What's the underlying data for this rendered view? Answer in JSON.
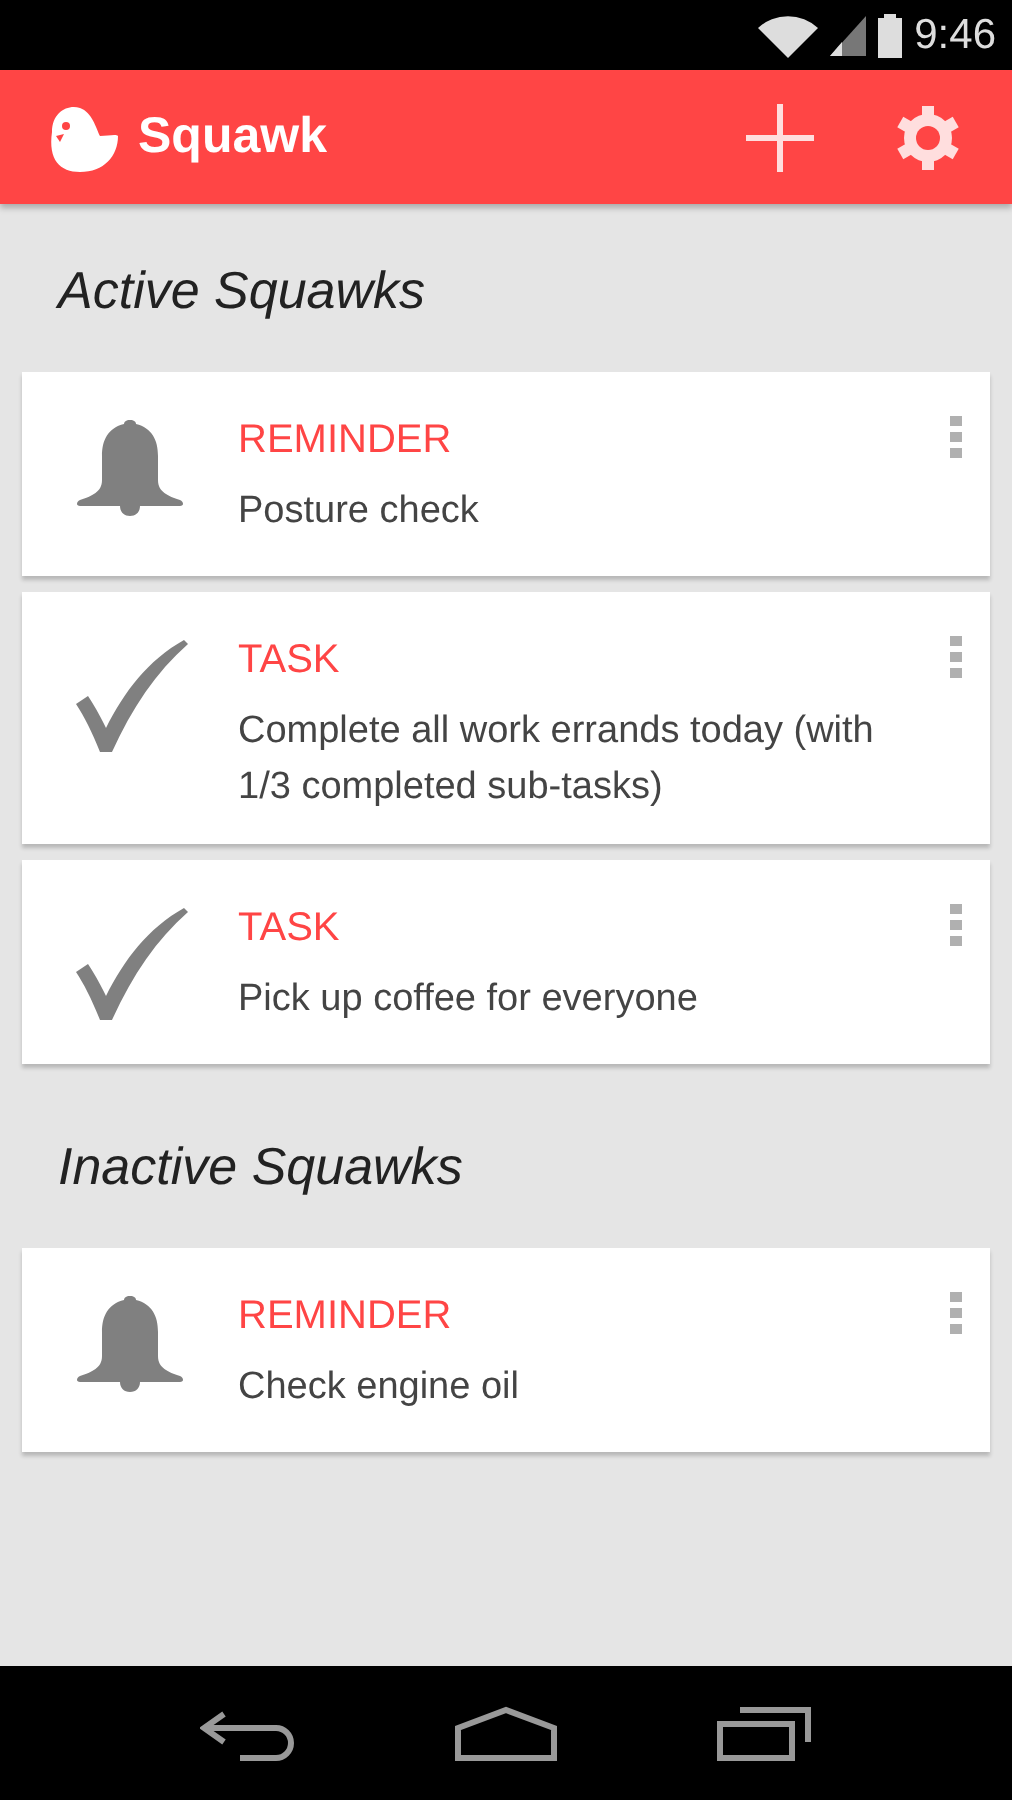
{
  "status_bar": {
    "time": "9:46"
  },
  "app_bar": {
    "title": "Squawk"
  },
  "sections": [
    {
      "title": "Active Squawks",
      "items": [
        {
          "kind": "reminder",
          "type": "REMINDER",
          "description": "Posture check"
        },
        {
          "kind": "task",
          "type": "TASK",
          "description": "Complete all work errands today (with 1/3 completed sub-tasks)"
        },
        {
          "kind": "task",
          "type": "TASK",
          "description": "Pick up coffee for everyone"
        }
      ]
    },
    {
      "title": "Inactive Squawks",
      "items": [
        {
          "kind": "reminder",
          "type": "REMINDER",
          "description": "Check engine oil"
        }
      ]
    }
  ]
}
